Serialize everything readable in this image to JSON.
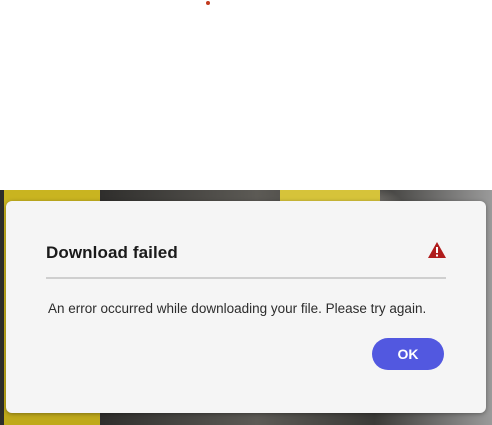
{
  "dialog": {
    "title": "Download failed",
    "message": "An error occurred while downloading your file. Please try again.",
    "ok_label": "OK",
    "icon": "alert-triangle-icon"
  },
  "colors": {
    "accent_button": "#5258e0",
    "alert_icon": "#b01c1c",
    "dialog_background": "#f5f5f5"
  }
}
